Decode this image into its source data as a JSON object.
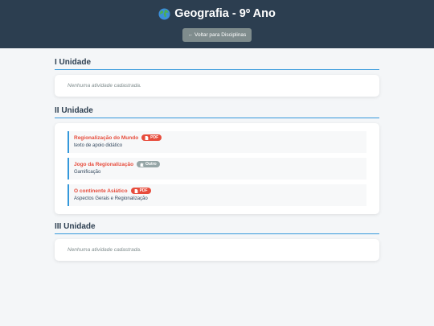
{
  "header": {
    "title": "Geografia - 9º Ano",
    "icon": "globe-icon",
    "back_label": "← Voltar para Disciplinas"
  },
  "units": [
    {
      "title": "I Unidade",
      "empty_text": "Nenhuma atividade cadastrada."
    },
    {
      "title": "II Unidade",
      "activities": [
        {
          "title": "Regionalização do Mundo",
          "badge": "PDF",
          "badge_icon": "file-icon",
          "description": "texto de apoio didático"
        },
        {
          "title": "Jogo da Regionalização",
          "badge": "Outro",
          "badge_icon": "puzzle-icon",
          "description": "Gamificação"
        },
        {
          "title": "O continente Asiático",
          "badge": "PDF",
          "badge_icon": "file-icon",
          "description": "Aspectos Gerais e Regionalização"
        }
      ]
    },
    {
      "title": "III Unidade",
      "empty_text": "Nenhuma atividade cadastrada."
    }
  ],
  "colors": {
    "header_bg": "#2c3e50",
    "accent": "#3498db",
    "activity_title": "#e74c3c",
    "pdf_badge": "#e74c3c",
    "other_badge": "#95a5a6"
  }
}
